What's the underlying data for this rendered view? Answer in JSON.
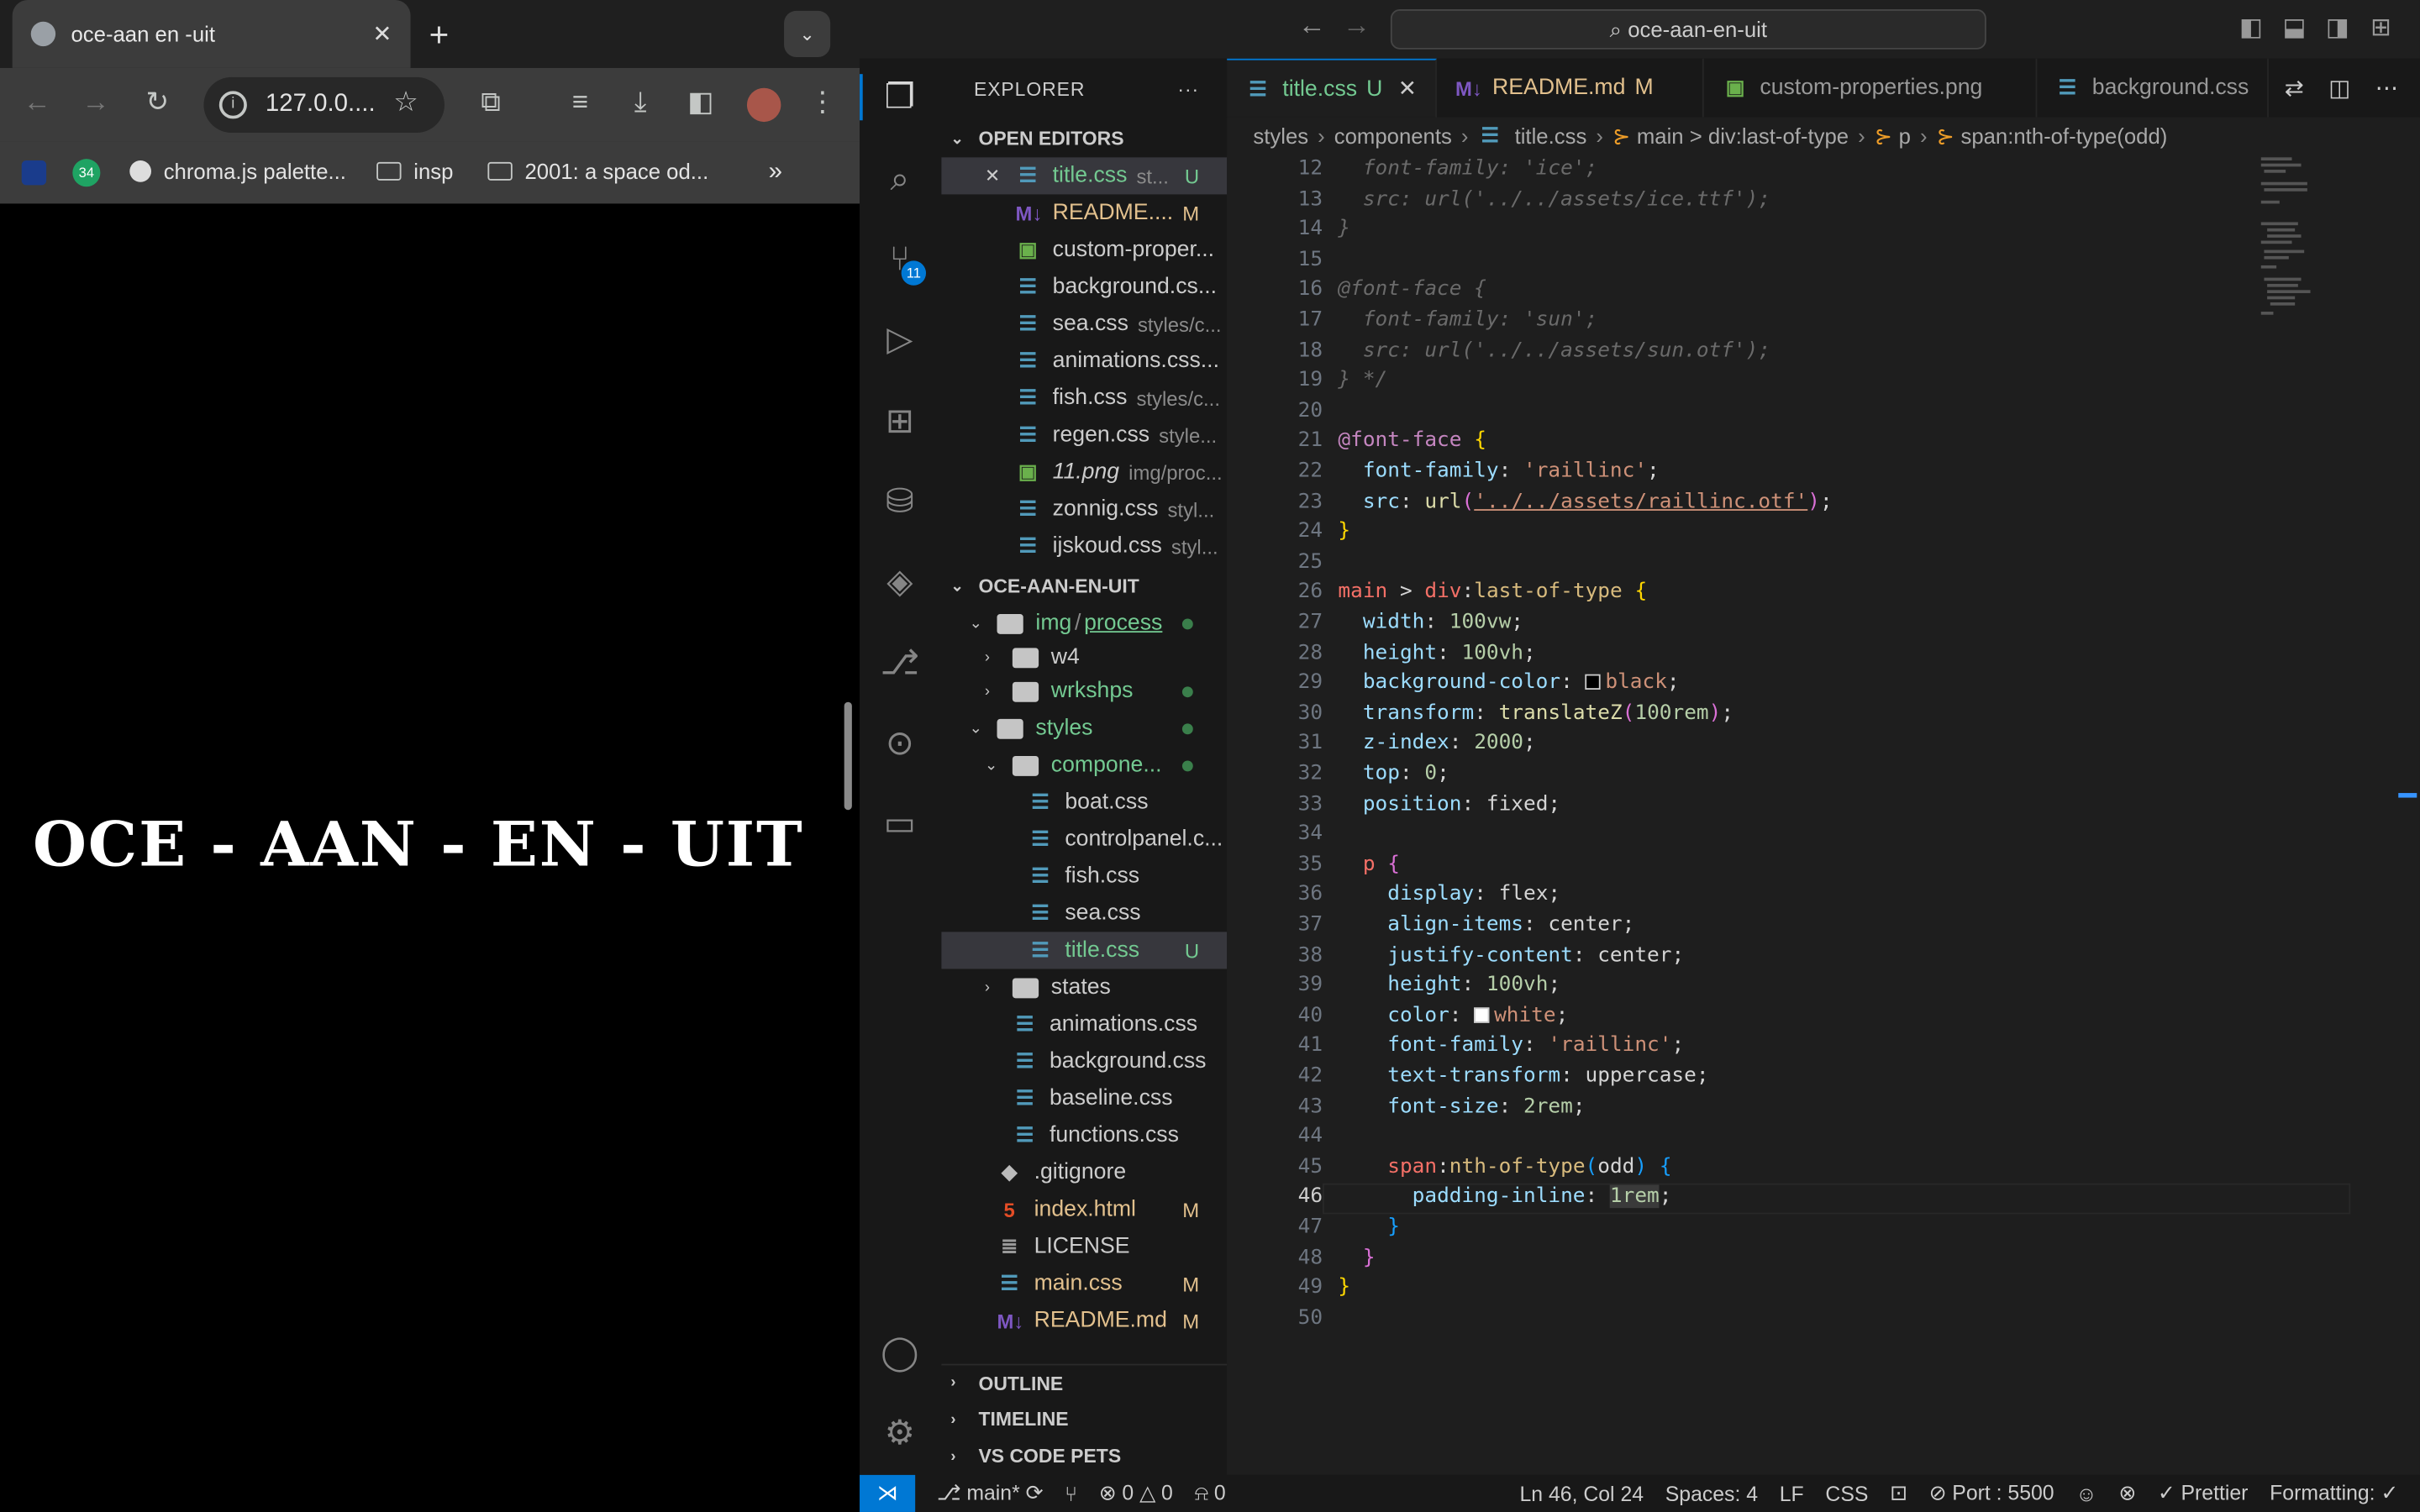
{
  "browser": {
    "tab_title": "oce-aan en -uit",
    "url": "127.0.0....",
    "bookmarks": [
      {
        "label": "chroma.js palette...",
        "icon": "bookmark-favicon"
      },
      {
        "label": "insp",
        "icon": "folder-icon"
      },
      {
        "label": "2001: a space od...",
        "icon": "folder-icon"
      }
    ],
    "extension_badge": "34",
    "page_heading": "OCE - AAN - EN - UIT"
  },
  "vscode": {
    "command_center": "oce-aan-en-uit",
    "source_control_badge": "11",
    "explorer_title": "EXPLORER",
    "explorer_more": "···",
    "open_editors_title": "OPEN EDITORS",
    "open_editors": [
      {
        "name": "title.css",
        "desc": "st...",
        "status": "U",
        "type": "css"
      },
      {
        "name": "README....",
        "desc": "",
        "status": "M",
        "type": "md"
      },
      {
        "name": "custom-proper...",
        "desc": "",
        "status": "",
        "type": "img"
      },
      {
        "name": "background.cs...",
        "desc": "",
        "status": "",
        "type": "css"
      },
      {
        "name": "sea.css",
        "desc": "styles/c...",
        "status": "",
        "type": "css"
      },
      {
        "name": "animations.css...",
        "desc": "",
        "status": "",
        "type": "css"
      },
      {
        "name": "fish.css",
        "desc": "styles/c...",
        "status": "",
        "type": "css"
      },
      {
        "name": "regen.css",
        "desc": "style...",
        "status": "",
        "type": "css"
      },
      {
        "name": "11.png",
        "desc": "img/proc...",
        "status": "",
        "type": "img"
      },
      {
        "name": "zonnig.css",
        "desc": "styl...",
        "status": "",
        "type": "css"
      },
      {
        "name": "ijskoud.css",
        "desc": "styl...",
        "status": "",
        "type": "css"
      }
    ],
    "project_title": "OCE-AAN-EN-UIT",
    "tree": {
      "img": "img",
      "process": "process",
      "w4": "w4",
      "wrkshps": "wrkshps",
      "styles": "styles",
      "components": "compone...",
      "component_files": [
        "boat.css",
        "controlpanel.c...",
        "fish.css",
        "sea.css",
        "title.css"
      ],
      "title_status": "U",
      "states": "states",
      "style_files": [
        "animations.css",
        "background.css",
        "baseline.css",
        "functions.css"
      ],
      "root_files": [
        {
          "name": ".gitignore",
          "status": "",
          "type": "git"
        },
        {
          "name": "index.html",
          "status": "M",
          "type": "html"
        },
        {
          "name": "LICENSE",
          "status": "",
          "type": "lic"
        },
        {
          "name": "main.css",
          "status": "M",
          "type": "css"
        },
        {
          "name": "README.md",
          "status": "M",
          "type": "md"
        }
      ]
    },
    "footer_sections": [
      "OUTLINE",
      "TIMELINE",
      "VS CODE PETS"
    ],
    "tabs": [
      {
        "name": "title.css",
        "status": "U",
        "type": "css",
        "active": true
      },
      {
        "name": "README.md",
        "status": "M",
        "type": "md",
        "active": false
      },
      {
        "name": "custom-properties.png",
        "status": "",
        "type": "img",
        "active": false
      },
      {
        "name": "background.css",
        "status": "",
        "type": "css",
        "active": false
      }
    ],
    "breadcrumbs": [
      "styles",
      "components",
      "title.css",
      "main > div:last-of-type",
      "p",
      "span:nth-of-type(odd)"
    ],
    "line_numbers": [
      "12",
      "13",
      "14",
      "15",
      "16",
      "17",
      "18",
      "19",
      "20",
      "21",
      "22",
      "23",
      "24",
      "25",
      "26",
      "27",
      "28",
      "29",
      "30",
      "31",
      "32",
      "33",
      "34",
      "35",
      "36",
      "37",
      "38",
      "39",
      "40",
      "41",
      "42",
      "43",
      "44",
      "45",
      "46",
      "47",
      "48",
      "49",
      "50"
    ],
    "current_line": "46",
    "statusbar": {
      "branch": "main*",
      "errors": "0",
      "warnings": "0",
      "ports": "0",
      "position": "Ln 46, Col 24",
      "spaces": "Spaces: 4",
      "eol": "LF",
      "language": "CSS",
      "port": "Port : 5500",
      "prettier": "Prettier",
      "formatting": "Formatting: ✓"
    }
  },
  "colors": {
    "accent": "#0078d4",
    "untracked": "#73c991",
    "modified": "#e2c08d",
    "chrome_bg": "#3c3c3c"
  }
}
